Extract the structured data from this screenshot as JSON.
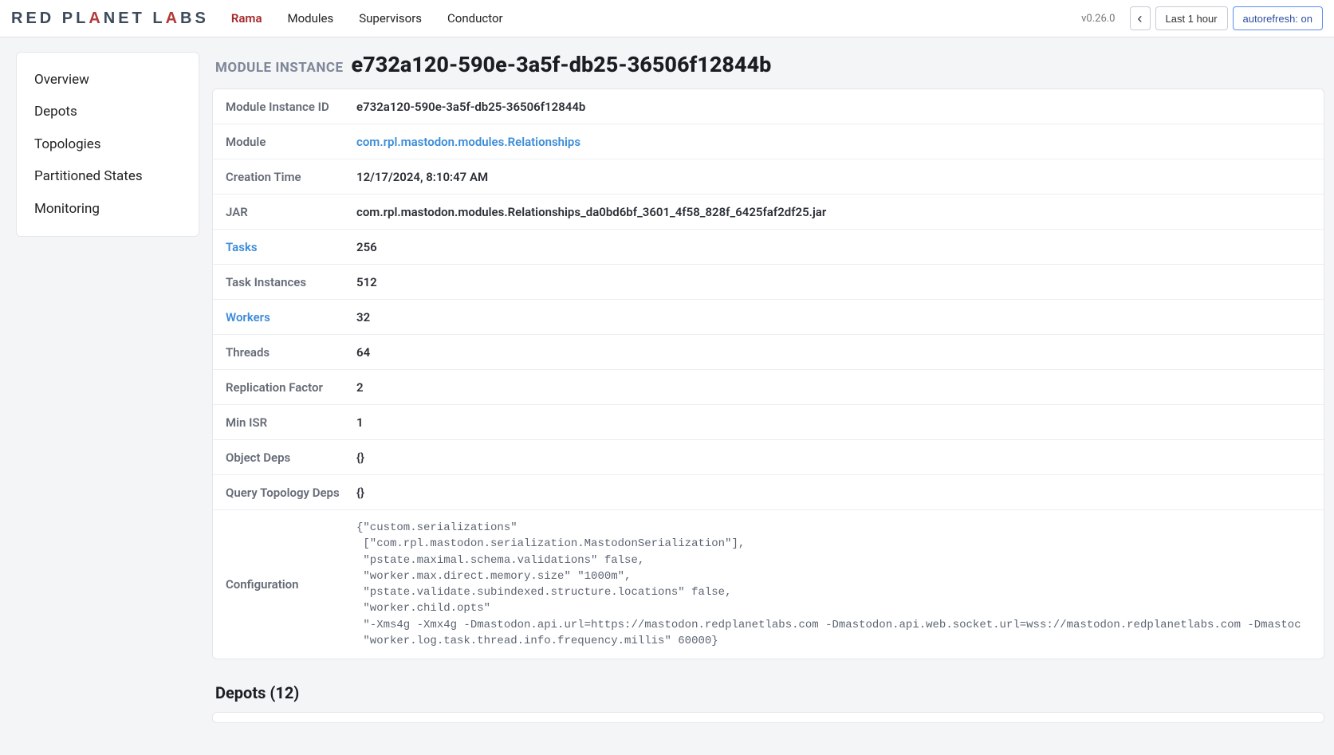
{
  "header": {
    "logo_text": "RED PLANET LABS",
    "nav": [
      "Rama",
      "Modules",
      "Supervisors",
      "Conductor"
    ],
    "version": "v0.26.0",
    "time_range": "Last 1 hour",
    "autorefresh": "autorefresh: on"
  },
  "sidebar": {
    "items": [
      "Overview",
      "Depots",
      "Topologies",
      "Partitioned States",
      "Monitoring"
    ]
  },
  "page": {
    "label": "MODULE INSTANCE",
    "title": "e732a120-590e-3a5f-db25-36506f12844b"
  },
  "kv": {
    "module_instance_id": {
      "label": "Module Instance ID",
      "value": "e732a120-590e-3a5f-db25-36506f12844b"
    },
    "module": {
      "label": "Module",
      "value": "com.rpl.mastodon.modules.Relationships"
    },
    "creation_time": {
      "label": "Creation Time",
      "value": "12/17/2024, 8:10:47 AM"
    },
    "jar": {
      "label": "JAR",
      "value": "com.rpl.mastodon.modules.Relationships_da0bd6bf_3601_4f58_828f_6425faf2df25.jar"
    },
    "tasks": {
      "label": "Tasks",
      "value": "256"
    },
    "task_instances": {
      "label": "Task Instances",
      "value": "512"
    },
    "workers": {
      "label": "Workers",
      "value": "32"
    },
    "threads": {
      "label": "Threads",
      "value": "64"
    },
    "replication_factor": {
      "label": "Replication Factor",
      "value": "2"
    },
    "min_isr": {
      "label": "Min ISR",
      "value": "1"
    },
    "object_deps": {
      "label": "Object Deps",
      "value": "{}"
    },
    "query_topo_deps": {
      "label": "Query Topology Deps",
      "value": "{}"
    },
    "configuration": {
      "label": "Configuration",
      "value": "{\"custom.serializations\"\n [\"com.rpl.mastodon.serialization.MastodonSerialization\"],\n \"pstate.maximal.schema.validations\" false,\n \"worker.max.direct.memory.size\" \"1000m\",\n \"pstate.validate.subindexed.structure.locations\" false,\n \"worker.child.opts\"\n \"-Xms4g -Xmx4g -Dmastodon.api.url=https://mastodon.redplanetlabs.com -Dmastodon.api.web.socket.url=wss://mastodon.redplanetlabs.com -Dmastoc\n \"worker.log.task.thread.info.frequency.millis\" 60000}"
    }
  },
  "sections": {
    "depots_title": "Depots (12)"
  }
}
